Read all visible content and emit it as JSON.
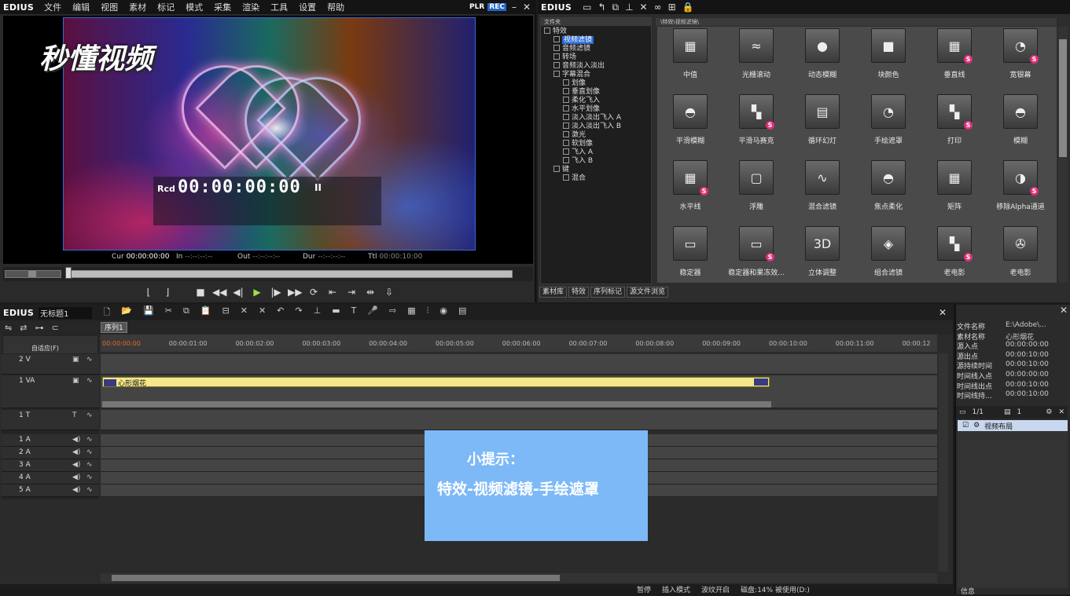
{
  "player": {
    "app_name": "EDIUS",
    "menu": [
      "文件",
      "编辑",
      "视图",
      "素材",
      "标记",
      "模式",
      "采集",
      "渲染",
      "工具",
      "设置",
      "帮助"
    ],
    "mode_plr": "PLR",
    "mode_rec": "REC",
    "watermark": "秒懂视频",
    "timecode_label": "Rcd",
    "timecode": "00:00:00:00",
    "timecode_status": "II",
    "cur_label": "Cur",
    "cur_value": "00:00:00:00",
    "in_label": "In",
    "in_value": "--:--:--:--",
    "out_label": "Out",
    "out_value": "--:--:--:--",
    "dur_label": "Dur",
    "dur_value": "--:--:--:--",
    "ttl_label": "Ttl",
    "ttl_value": "00:00:10:00"
  },
  "palette": {
    "app_name": "EDIUS",
    "folder_header": "文件夹",
    "effects_header": "\\特效\\视频滤镜\\",
    "tree": [
      {
        "label": "特效",
        "indent": 0
      },
      {
        "label": "视频滤镜",
        "indent": 1,
        "selected": true
      },
      {
        "label": "音频滤镜",
        "indent": 1
      },
      {
        "label": "转场",
        "indent": 1
      },
      {
        "label": "音频淡入淡出",
        "indent": 1
      },
      {
        "label": "字幕混合",
        "indent": 1
      },
      {
        "label": "划像",
        "indent": 2
      },
      {
        "label": "垂直划像",
        "indent": 2
      },
      {
        "label": "柔化飞入",
        "indent": 2
      },
      {
        "label": "水平划像",
        "indent": 2
      },
      {
        "label": "淡入淡出飞入 A",
        "indent": 2
      },
      {
        "label": "淡入淡出飞入 B",
        "indent": 2
      },
      {
        "label": "激光",
        "indent": 2
      },
      {
        "label": "软划像",
        "indent": 2
      },
      {
        "label": "飞入 A",
        "indent": 2
      },
      {
        "label": "飞入 B",
        "indent": 2
      },
      {
        "label": "键",
        "indent": 1
      },
      {
        "label": "混合",
        "indent": 2
      }
    ],
    "effects": [
      {
        "label": "中值",
        "glyph": "▦",
        "s": false
      },
      {
        "label": "光栅滚动",
        "glyph": "≈",
        "s": false
      },
      {
        "label": "动态模糊",
        "glyph": "●",
        "s": false
      },
      {
        "label": "块颜色",
        "glyph": "■",
        "s": false
      },
      {
        "label": "垂直线",
        "glyph": "▦",
        "s": true
      },
      {
        "label": "宽银幕",
        "glyph": "◔",
        "s": true
      },
      {
        "label": "平滑模糊",
        "glyph": "◓",
        "s": false
      },
      {
        "label": "平滑马赛克",
        "glyph": "▚",
        "s": true
      },
      {
        "label": "循环幻灯",
        "glyph": "▤",
        "s": false
      },
      {
        "label": "手绘遮罩",
        "glyph": "◔",
        "s": false
      },
      {
        "label": "打印",
        "glyph": "▚",
        "s": true
      },
      {
        "label": "模糊",
        "glyph": "◓",
        "s": false
      },
      {
        "label": "水平线",
        "glyph": "▦",
        "s": true
      },
      {
        "label": "浮雕",
        "glyph": "▢",
        "s": false
      },
      {
        "label": "混合滤镜",
        "glyph": "∿",
        "s": false
      },
      {
        "label": "焦点柔化",
        "glyph": "◓",
        "s": false
      },
      {
        "label": "矩阵",
        "glyph": "▦",
        "s": false
      },
      {
        "label": "移除Alpha通道",
        "glyph": "◑",
        "s": true
      },
      {
        "label": "稳定器",
        "glyph": "▭",
        "s": false
      },
      {
        "label": "稳定器和果冻效...",
        "glyph": "▭",
        "s": true
      },
      {
        "label": "立体调整",
        "glyph": "3D",
        "s": false
      },
      {
        "label": "组合滤镜",
        "glyph": "◈",
        "s": false
      },
      {
        "label": "老电影",
        "glyph": "▚",
        "s": true
      },
      {
        "label": "老电影",
        "glyph": "✇",
        "s": false
      }
    ],
    "tabs": [
      "素材库",
      "特效",
      "序列标记",
      "源文件浏览"
    ]
  },
  "timeline": {
    "app_name": "EDIUS",
    "project_name": "无标题1",
    "sequence_tab": "序列1",
    "fit_label": "自适应(F)",
    "ruler": [
      "00:00:00:00",
      "00:00:01:00",
      "00:00:02:00",
      "00:00:03:00",
      "00:00:04:00",
      "00:00:05:00",
      "00:00:06:00",
      "00:00:07:00",
      "00:00:08:00",
      "00:00:09:00",
      "00:00:10:00",
      "00:00:11:00",
      "00:00:12"
    ],
    "tracks": [
      {
        "name": "2 V"
      },
      {
        "name": "1 VA"
      },
      {
        "name": "1 T"
      },
      {
        "name": "1 A"
      },
      {
        "name": "2 A"
      },
      {
        "name": "3 A"
      },
      {
        "name": "4 A"
      },
      {
        "name": "5 A"
      }
    ],
    "clip_name": "心形烟花",
    "tip_title": "小提示：",
    "tip_body": "特效-视频滤镜-手绘遮罩",
    "status": [
      "暂停",
      "插入模式",
      "波纹开启",
      "磁盘:14% 被使用(D:)"
    ]
  },
  "info": {
    "rows": [
      {
        "k": "文件名称",
        "v": "E:\\Adobe\\..."
      },
      {
        "k": "素材名称",
        "v": "心形烟花"
      },
      {
        "k": "源入点",
        "v": "00:00:00:00"
      },
      {
        "k": "源出点",
        "v": "00:00:10:00"
      },
      {
        "k": "源持续时间",
        "v": "00:00:10:00"
      },
      {
        "k": "时间线入点",
        "v": "00:00:00:00"
      },
      {
        "k": "时间线出点",
        "v": "00:00:10:00"
      },
      {
        "k": "时间线持...",
        "v": "00:00:10:00"
      }
    ],
    "layer_page": "1/1",
    "layer_count": "1",
    "layer_item": "视频布局",
    "footer": "信息"
  }
}
